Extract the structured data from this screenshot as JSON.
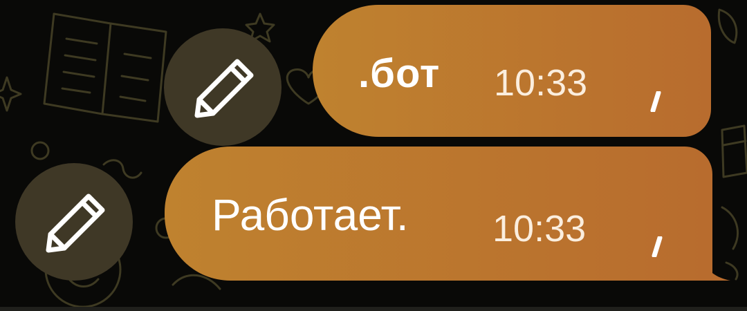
{
  "chat": {
    "messages": [
      {
        "text": ".бот",
        "time": "10:33",
        "status_icon": "sending-clock-icon",
        "action_icon": "pencil-icon"
      },
      {
        "text": "Работает.",
        "time": "10:33",
        "status_icon": "sending-clock-icon",
        "action_icon": "pencil-icon"
      }
    ]
  },
  "colors": {
    "background": "#090907",
    "bubble_start": "#bf822f",
    "bubble_end": "#b86c2e",
    "edit_button": "#3f3826",
    "text": "#ffffff"
  }
}
